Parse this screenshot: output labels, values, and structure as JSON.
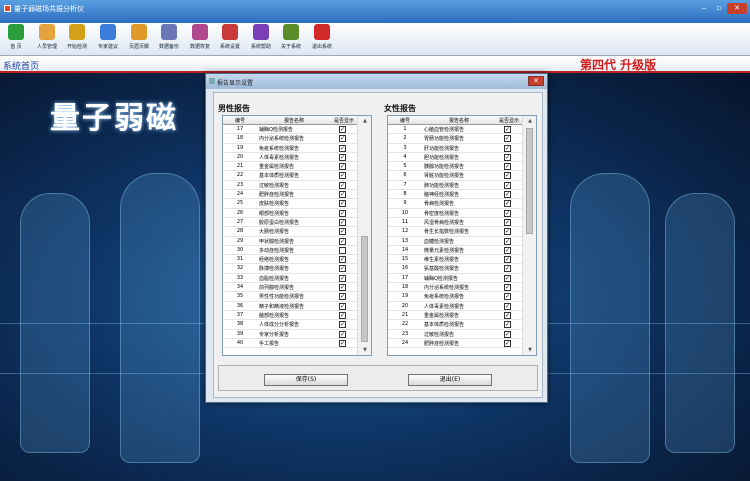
{
  "window": {
    "title": "量子弱磁场共振分析仪",
    "minimize": "‒",
    "maximize": "▫",
    "close": "✕"
  },
  "toolbar": [
    {
      "label": "首 页",
      "icon": "home-icon",
      "color": "#2a9d3c"
    },
    {
      "label": "人员管理",
      "icon": "users-icon",
      "color": "#e6a23c"
    },
    {
      "label": "开始检测",
      "icon": "hand-icon",
      "color": "#d4a017"
    },
    {
      "label": "专家建议",
      "icon": "expert-icon",
      "color": "#3b7dd8"
    },
    {
      "label": "页眉页脚",
      "icon": "edit-icon",
      "color": "#e09a2a"
    },
    {
      "label": "数据备份",
      "icon": "backup-icon",
      "color": "#6a78b8"
    },
    {
      "label": "数据恢复",
      "icon": "restore-icon",
      "color": "#b04a8c"
    },
    {
      "label": "系统设置",
      "icon": "settings-icon",
      "color": "#c93a3a"
    },
    {
      "label": "系统帮助",
      "icon": "help-icon",
      "color": "#7b3fb5"
    },
    {
      "label": "关于系统",
      "icon": "about-icon",
      "color": "#5b8c2a"
    },
    {
      "label": "退出系统",
      "icon": "power-icon",
      "color": "#d02a2a"
    }
  ],
  "status": {
    "breadcrumb": "系统首页",
    "generation": "第四代  升级版"
  },
  "background": {
    "title": "量子弱磁"
  },
  "dialog": {
    "title": "报告显示设置",
    "close_label": "✕",
    "headers": {
      "num": "编号",
      "name": "报告名称",
      "show": "是否显示"
    },
    "male": {
      "title": "男性报告",
      "rows": [
        {
          "num": "17",
          "name": "辅酶Q检测报告",
          "checked": true
        },
        {
          "num": "18",
          "name": "内分泌系统检测报告",
          "checked": true
        },
        {
          "num": "19",
          "name": "免疫系统检测报告",
          "checked": true
        },
        {
          "num": "20",
          "name": "人体毒素检测报告",
          "checked": true
        },
        {
          "num": "21",
          "name": "重金属检测报告",
          "checked": true
        },
        {
          "num": "22",
          "name": "基本体质检测报告",
          "checked": true
        },
        {
          "num": "23",
          "name": "过敏检测报告",
          "checked": true
        },
        {
          "num": "24",
          "name": "肥胖症检测报告",
          "checked": true
        },
        {
          "num": "25",
          "name": "皮肤检测报告",
          "checked": true
        },
        {
          "num": "26",
          "name": "眼部检测报告",
          "checked": true
        },
        {
          "num": "27",
          "name": "胶原蛋白检测报告",
          "checked": true
        },
        {
          "num": "28",
          "name": "大肠检测报告",
          "checked": true
        },
        {
          "num": "29",
          "name": "甲状腺检测报告",
          "checked": true
        },
        {
          "num": "30",
          "name": "多动症检测报告",
          "checked": false
        },
        {
          "num": "31",
          "name": "经络检测报告",
          "checked": true
        },
        {
          "num": "32",
          "name": "脉搏检测报告",
          "checked": true
        },
        {
          "num": "33",
          "name": "血脂检测报告",
          "checked": true
        },
        {
          "num": "34",
          "name": "前列腺检测报告",
          "checked": true
        },
        {
          "num": "35",
          "name": "男性性功能检测报告",
          "checked": true
        },
        {
          "num": "36",
          "name": "精子和精液检测报告",
          "checked": true
        },
        {
          "num": "37",
          "name": "脑部检测报告",
          "checked": true
        },
        {
          "num": "38",
          "name": "人体成分分析报告",
          "checked": true
        },
        {
          "num": "39",
          "name": "专家分析报告",
          "checked": true
        },
        {
          "num": "40",
          "name": "手工报告",
          "checked": true
        }
      ]
    },
    "female": {
      "title": "女性报告",
      "rows": [
        {
          "num": "1",
          "name": "心脑血管检测报告",
          "checked": true
        },
        {
          "num": "2",
          "name": "胃肠功能检测报告",
          "checked": true
        },
        {
          "num": "3",
          "name": "肝功能检测报告",
          "checked": true
        },
        {
          "num": "4",
          "name": "胆功能检测报告",
          "checked": true
        },
        {
          "num": "5",
          "name": "胰腺功能检测报告",
          "checked": true
        },
        {
          "num": "6",
          "name": "肾脏功能检测报告",
          "checked": true
        },
        {
          "num": "7",
          "name": "肺功能检测报告",
          "checked": true
        },
        {
          "num": "8",
          "name": "脑神经检测报告",
          "checked": true
        },
        {
          "num": "9",
          "name": "骨病检测报告",
          "checked": true
        },
        {
          "num": "10",
          "name": "骨密度检测报告",
          "checked": true
        },
        {
          "num": "11",
          "name": "风湿骨病检测报告",
          "checked": true
        },
        {
          "num": "12",
          "name": "骨生长指数检测报告",
          "checked": true
        },
        {
          "num": "13",
          "name": "血糖检测报告",
          "checked": true
        },
        {
          "num": "14",
          "name": "微量元素检测报告",
          "checked": true
        },
        {
          "num": "15",
          "name": "维生素检测报告",
          "checked": true
        },
        {
          "num": "16",
          "name": "氨基酸检测报告",
          "checked": true
        },
        {
          "num": "17",
          "name": "辅酶Q检测报告",
          "checked": true
        },
        {
          "num": "18",
          "name": "内分泌系统检测报告",
          "checked": true
        },
        {
          "num": "19",
          "name": "免疫系统检测报告",
          "checked": true
        },
        {
          "num": "20",
          "name": "人体毒素检测报告",
          "checked": true
        },
        {
          "num": "21",
          "name": "重金属检测报告",
          "checked": true
        },
        {
          "num": "22",
          "name": "基本体质检测报告",
          "checked": true
        },
        {
          "num": "23",
          "name": "过敏检测报告",
          "checked": true
        },
        {
          "num": "24",
          "name": "肥胖症检测报告",
          "checked": true
        }
      ]
    },
    "save_label": "保存(S)",
    "exit_label": "退出(E)"
  }
}
